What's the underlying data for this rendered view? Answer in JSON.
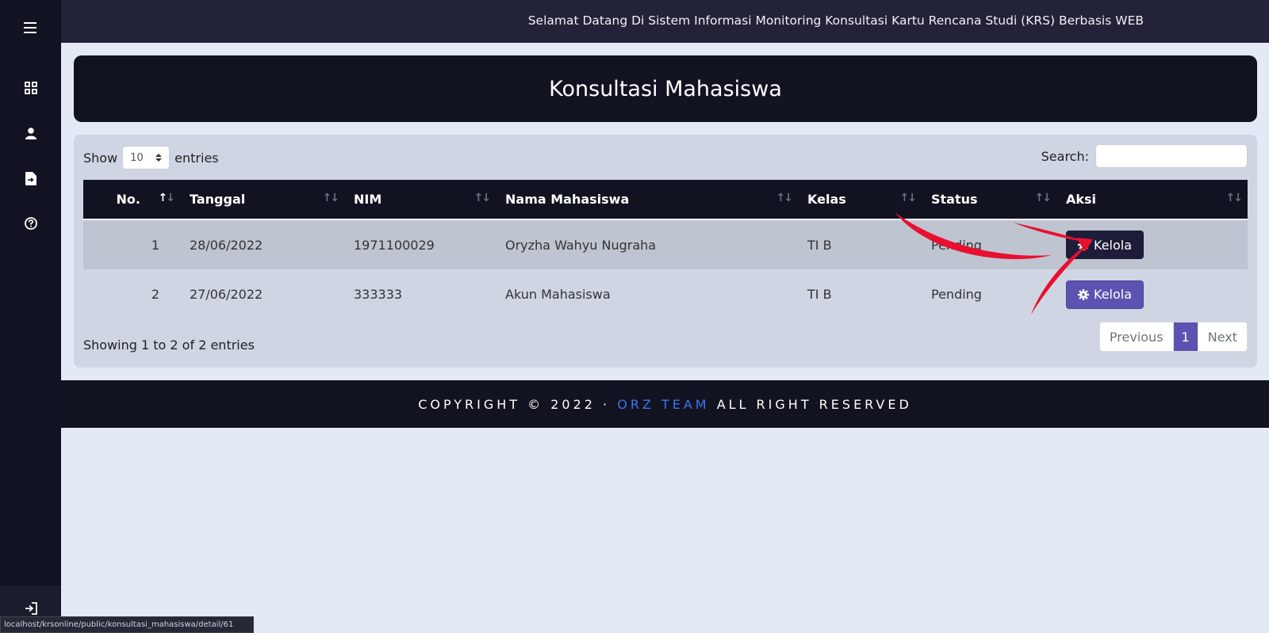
{
  "topbar": {
    "title": "Selamat Datang Di Sistem Informasi Monitoring Konsultasi Kartu Rencana Studi (KRS) Berbasis WEB"
  },
  "sidebar": {
    "items": [
      {
        "icon": "hamburger-menu-icon"
      },
      {
        "icon": "dashboard-grid-icon"
      },
      {
        "icon": "user-icon"
      },
      {
        "icon": "file-export-icon"
      },
      {
        "icon": "help-circle-icon"
      },
      {
        "icon": "logout-icon"
      }
    ]
  },
  "page": {
    "title": "Konsultasi Mahasiswa"
  },
  "table_controls": {
    "show_label": "Show",
    "entries_value": "10",
    "entries_label": "entries",
    "search_label": "Search:",
    "search_value": ""
  },
  "table": {
    "columns": [
      "No.",
      "Tanggal",
      "NIM",
      "Nama Mahasiswa",
      "Kelas",
      "Status",
      "Aksi"
    ],
    "rows": [
      {
        "no": "1",
        "tanggal": "28/06/2022",
        "nim": "1971100029",
        "nama": "Oryzha Wahyu Nugraha",
        "kelas": "TI B",
        "status": "Pending",
        "aksi": "Kelola"
      },
      {
        "no": "2",
        "tanggal": "27/06/2022",
        "nim": "333333",
        "nama": "Akun Mahasiswa",
        "kelas": "TI B",
        "status": "Pending",
        "aksi": "Kelola"
      }
    ]
  },
  "table_info": "Showing 1 to 2 of 2 entries",
  "pagination": {
    "previous": "Previous",
    "current": "1",
    "next": "Next"
  },
  "footer": {
    "prefix": "COPYRIGHT © 2022 · ",
    "team": "ORZ TEAM",
    "suffix": " ALL RIGHT RESERVED"
  },
  "status_bar": {
    "url": "localhost/krsonline/public/konsultasi_mahasiswa/detail/61"
  },
  "colors": {
    "sidebar": "#121322",
    "topbar": "#222238",
    "banner": "#111320",
    "accent_purple": "#5c53b0",
    "button_dark": "#1d1d3a",
    "link_blue": "#3c74f0",
    "annotation_red": "#e8102e"
  }
}
